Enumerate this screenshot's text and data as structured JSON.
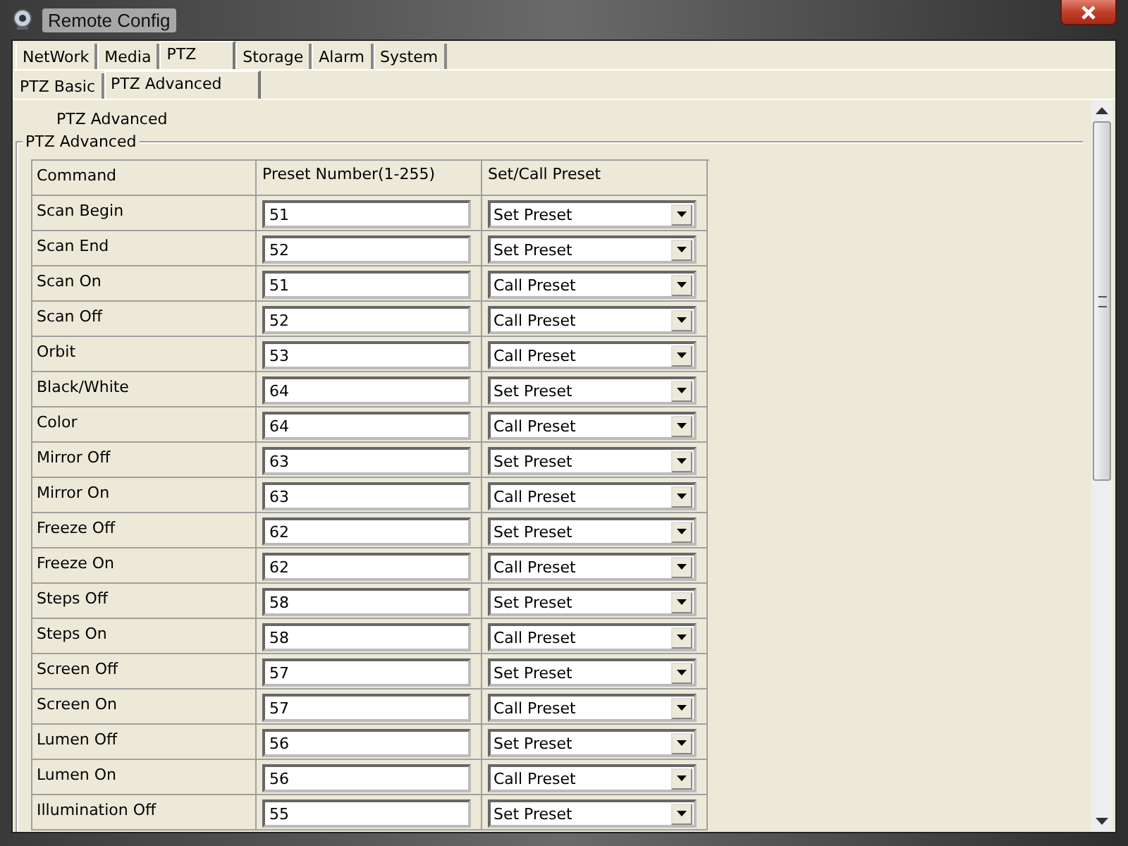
{
  "window": {
    "title": "Remote Config"
  },
  "tabs": [
    {
      "label": "NetWork",
      "selected": false
    },
    {
      "label": "Media",
      "selected": false
    },
    {
      "label": "PTZ",
      "selected": true
    },
    {
      "label": "Storage",
      "selected": false
    },
    {
      "label": "Alarm",
      "selected": false
    },
    {
      "label": "System",
      "selected": false
    }
  ],
  "subtabs": [
    {
      "label": "PTZ Basic",
      "selected": false
    },
    {
      "label": "PTZ Advanced",
      "selected": true
    }
  ],
  "page_heading": "PTZ Advanced",
  "group": {
    "title": "PTZ Advanced",
    "table": {
      "columns": [
        "Command",
        "Preset Number(1-255)",
        "Set/Call Preset"
      ],
      "rows": [
        {
          "command": "Scan Begin",
          "preset": "51",
          "mode": "Set Preset"
        },
        {
          "command": "Scan End",
          "preset": "52",
          "mode": "Set Preset"
        },
        {
          "command": "Scan On",
          "preset": "51",
          "mode": "Call Preset"
        },
        {
          "command": "Scan Off",
          "preset": "52",
          "mode": "Call Preset"
        },
        {
          "command": "Orbit",
          "preset": "53",
          "mode": "Call Preset"
        },
        {
          "command": "Black/White",
          "preset": "64",
          "mode": "Set Preset"
        },
        {
          "command": "Color",
          "preset": "64",
          "mode": "Call Preset"
        },
        {
          "command": "Mirror Off",
          "preset": "63",
          "mode": "Set Preset"
        },
        {
          "command": "Mirror On",
          "preset": "63",
          "mode": "Call Preset"
        },
        {
          "command": "Freeze Off",
          "preset": "62",
          "mode": "Set Preset"
        },
        {
          "command": "Freeze On",
          "preset": "62",
          "mode": "Call Preset"
        },
        {
          "command": "Steps Off",
          "preset": "58",
          "mode": "Set Preset"
        },
        {
          "command": "Steps On",
          "preset": "58",
          "mode": "Call Preset"
        },
        {
          "command": "Screen Off",
          "preset": "57",
          "mode": "Set Preset"
        },
        {
          "command": "Screen On",
          "preset": "57",
          "mode": "Call Preset"
        },
        {
          "command": "Lumen Off",
          "preset": "56",
          "mode": "Set Preset"
        },
        {
          "command": "Lumen On",
          "preset": "56",
          "mode": "Call Preset"
        },
        {
          "command": "Illumination Off",
          "preset": "55",
          "mode": "Set Preset"
        }
      ]
    }
  }
}
